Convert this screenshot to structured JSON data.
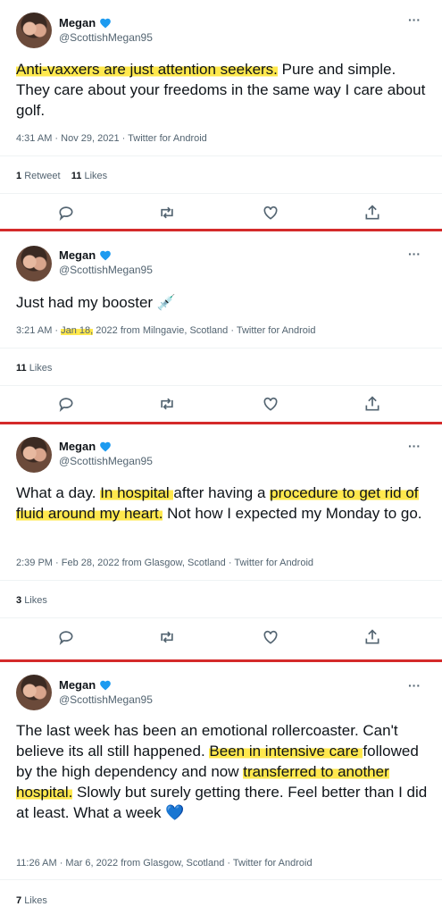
{
  "tweets": [
    {
      "name": "Megan",
      "handle": "@ScottishMegan95",
      "text_parts": [
        {
          "t": "Anti-vaxxers are just attention seekers.",
          "hl": true
        },
        {
          "t": " Pure and simple. They care about your freedoms in the same way I care about golf.",
          "hl": false
        }
      ],
      "meta": "4:31 AM · Nov 29, 2021 · Twitter for Android",
      "retweets_count": "1",
      "retweets_label": "Retweet",
      "likes_count": "11",
      "likes_label": "Likes"
    },
    {
      "name": "Megan",
      "handle": "@ScottishMegan95",
      "text_parts": [
        {
          "t": "Just had my booster 💉",
          "hl": false
        }
      ],
      "meta_parts": [
        {
          "t": "3:21 AM · ",
          "hl": false
        },
        {
          "t": "Jan 18,",
          "hl": true
        },
        {
          "t": " 2022 from Milngavie, Scotland · Twitter for Android",
          "hl": false
        }
      ],
      "likes_count": "11",
      "likes_label": "Likes"
    },
    {
      "name": "Megan",
      "handle": "@ScottishMegan95",
      "text_parts": [
        {
          "t": "What a day. ",
          "hl": false
        },
        {
          "t": "In hospital ",
          "hl": true
        },
        {
          "t": "after having a ",
          "hl": false
        },
        {
          "t": "procedure to get rid of fluid around my heart.",
          "hl": true
        },
        {
          "t": " Not how I expected my Monday to go.",
          "hl": false
        }
      ],
      "meta": "2:39 PM · Feb 28, 2022 from Glasgow, Scotland · Twitter for Android",
      "likes_count": "3",
      "likes_label": "Likes"
    },
    {
      "name": "Megan",
      "handle": "@ScottishMegan95",
      "text_parts": [
        {
          "t": "The last week has been an emotional rollercoaster. Can't believe its all still happened. ",
          "hl": false
        },
        {
          "t": "Been in intensive care ",
          "hl": true
        },
        {
          "t": "followed by the high dependency and now ",
          "hl": false
        },
        {
          "t": "transferred to another hospital.",
          "hl": true
        },
        {
          "t": " Slowly but surely getting there. Feel better than I did at least. What a week 💙",
          "hl": false
        }
      ],
      "meta": "11:26 AM · Mar 6, 2022 from Glasgow, Scotland · Twitter for Android",
      "likes_count": "7",
      "likes_label": "Likes"
    }
  ],
  "icons": {
    "more": "more-icon",
    "reply": "reply-icon",
    "retweet": "retweet-icon",
    "like": "like-icon",
    "share": "share-icon",
    "verified": "verified-badge-icon"
  },
  "colors": {
    "highlight": "#ffe84d",
    "separator": "#d42a2a",
    "verified": "#1d9bf0",
    "muted": "#536471"
  }
}
